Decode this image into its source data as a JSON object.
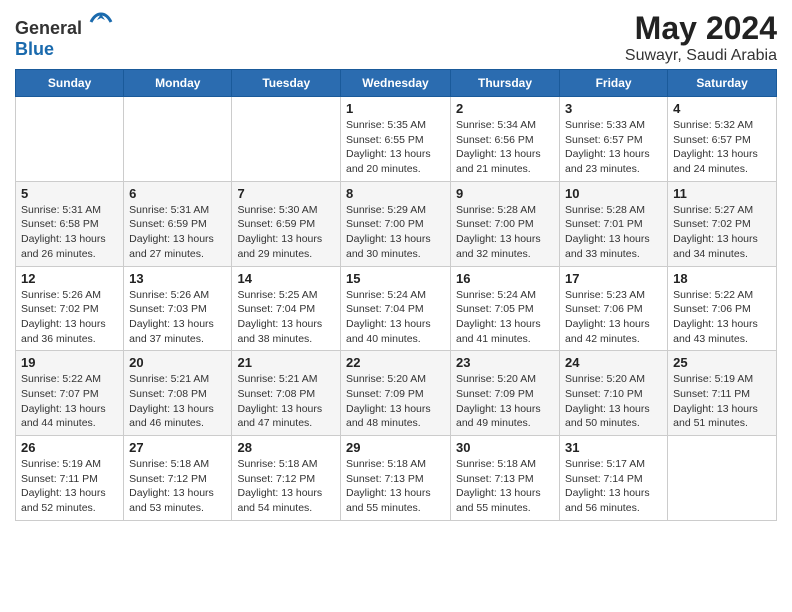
{
  "logo": {
    "general": "General",
    "blue": "Blue"
  },
  "header": {
    "title": "May 2024",
    "subtitle": "Suwayr, Saudi Arabia"
  },
  "weekdays": [
    "Sunday",
    "Monday",
    "Tuesday",
    "Wednesday",
    "Thursday",
    "Friday",
    "Saturday"
  ],
  "weeks": [
    [
      {
        "day": "",
        "info": ""
      },
      {
        "day": "",
        "info": ""
      },
      {
        "day": "",
        "info": ""
      },
      {
        "day": "1",
        "info": "Sunrise: 5:35 AM\nSunset: 6:55 PM\nDaylight: 13 hours\nand 20 minutes."
      },
      {
        "day": "2",
        "info": "Sunrise: 5:34 AM\nSunset: 6:56 PM\nDaylight: 13 hours\nand 21 minutes."
      },
      {
        "day": "3",
        "info": "Sunrise: 5:33 AM\nSunset: 6:57 PM\nDaylight: 13 hours\nand 23 minutes."
      },
      {
        "day": "4",
        "info": "Sunrise: 5:32 AM\nSunset: 6:57 PM\nDaylight: 13 hours\nand 24 minutes."
      }
    ],
    [
      {
        "day": "5",
        "info": "Sunrise: 5:31 AM\nSunset: 6:58 PM\nDaylight: 13 hours\nand 26 minutes."
      },
      {
        "day": "6",
        "info": "Sunrise: 5:31 AM\nSunset: 6:59 PM\nDaylight: 13 hours\nand 27 minutes."
      },
      {
        "day": "7",
        "info": "Sunrise: 5:30 AM\nSunset: 6:59 PM\nDaylight: 13 hours\nand 29 minutes."
      },
      {
        "day": "8",
        "info": "Sunrise: 5:29 AM\nSunset: 7:00 PM\nDaylight: 13 hours\nand 30 minutes."
      },
      {
        "day": "9",
        "info": "Sunrise: 5:28 AM\nSunset: 7:00 PM\nDaylight: 13 hours\nand 32 minutes."
      },
      {
        "day": "10",
        "info": "Sunrise: 5:28 AM\nSunset: 7:01 PM\nDaylight: 13 hours\nand 33 minutes."
      },
      {
        "day": "11",
        "info": "Sunrise: 5:27 AM\nSunset: 7:02 PM\nDaylight: 13 hours\nand 34 minutes."
      }
    ],
    [
      {
        "day": "12",
        "info": "Sunrise: 5:26 AM\nSunset: 7:02 PM\nDaylight: 13 hours\nand 36 minutes."
      },
      {
        "day": "13",
        "info": "Sunrise: 5:26 AM\nSunset: 7:03 PM\nDaylight: 13 hours\nand 37 minutes."
      },
      {
        "day": "14",
        "info": "Sunrise: 5:25 AM\nSunset: 7:04 PM\nDaylight: 13 hours\nand 38 minutes."
      },
      {
        "day": "15",
        "info": "Sunrise: 5:24 AM\nSunset: 7:04 PM\nDaylight: 13 hours\nand 40 minutes."
      },
      {
        "day": "16",
        "info": "Sunrise: 5:24 AM\nSunset: 7:05 PM\nDaylight: 13 hours\nand 41 minutes."
      },
      {
        "day": "17",
        "info": "Sunrise: 5:23 AM\nSunset: 7:06 PM\nDaylight: 13 hours\nand 42 minutes."
      },
      {
        "day": "18",
        "info": "Sunrise: 5:22 AM\nSunset: 7:06 PM\nDaylight: 13 hours\nand 43 minutes."
      }
    ],
    [
      {
        "day": "19",
        "info": "Sunrise: 5:22 AM\nSunset: 7:07 PM\nDaylight: 13 hours\nand 44 minutes."
      },
      {
        "day": "20",
        "info": "Sunrise: 5:21 AM\nSunset: 7:08 PM\nDaylight: 13 hours\nand 46 minutes."
      },
      {
        "day": "21",
        "info": "Sunrise: 5:21 AM\nSunset: 7:08 PM\nDaylight: 13 hours\nand 47 minutes."
      },
      {
        "day": "22",
        "info": "Sunrise: 5:20 AM\nSunset: 7:09 PM\nDaylight: 13 hours\nand 48 minutes."
      },
      {
        "day": "23",
        "info": "Sunrise: 5:20 AM\nSunset: 7:09 PM\nDaylight: 13 hours\nand 49 minutes."
      },
      {
        "day": "24",
        "info": "Sunrise: 5:20 AM\nSunset: 7:10 PM\nDaylight: 13 hours\nand 50 minutes."
      },
      {
        "day": "25",
        "info": "Sunrise: 5:19 AM\nSunset: 7:11 PM\nDaylight: 13 hours\nand 51 minutes."
      }
    ],
    [
      {
        "day": "26",
        "info": "Sunrise: 5:19 AM\nSunset: 7:11 PM\nDaylight: 13 hours\nand 52 minutes."
      },
      {
        "day": "27",
        "info": "Sunrise: 5:18 AM\nSunset: 7:12 PM\nDaylight: 13 hours\nand 53 minutes."
      },
      {
        "day": "28",
        "info": "Sunrise: 5:18 AM\nSunset: 7:12 PM\nDaylight: 13 hours\nand 54 minutes."
      },
      {
        "day": "29",
        "info": "Sunrise: 5:18 AM\nSunset: 7:13 PM\nDaylight: 13 hours\nand 55 minutes."
      },
      {
        "day": "30",
        "info": "Sunrise: 5:18 AM\nSunset: 7:13 PM\nDaylight: 13 hours\nand 55 minutes."
      },
      {
        "day": "31",
        "info": "Sunrise: 5:17 AM\nSunset: 7:14 PM\nDaylight: 13 hours\nand 56 minutes."
      },
      {
        "day": "",
        "info": ""
      }
    ]
  ]
}
